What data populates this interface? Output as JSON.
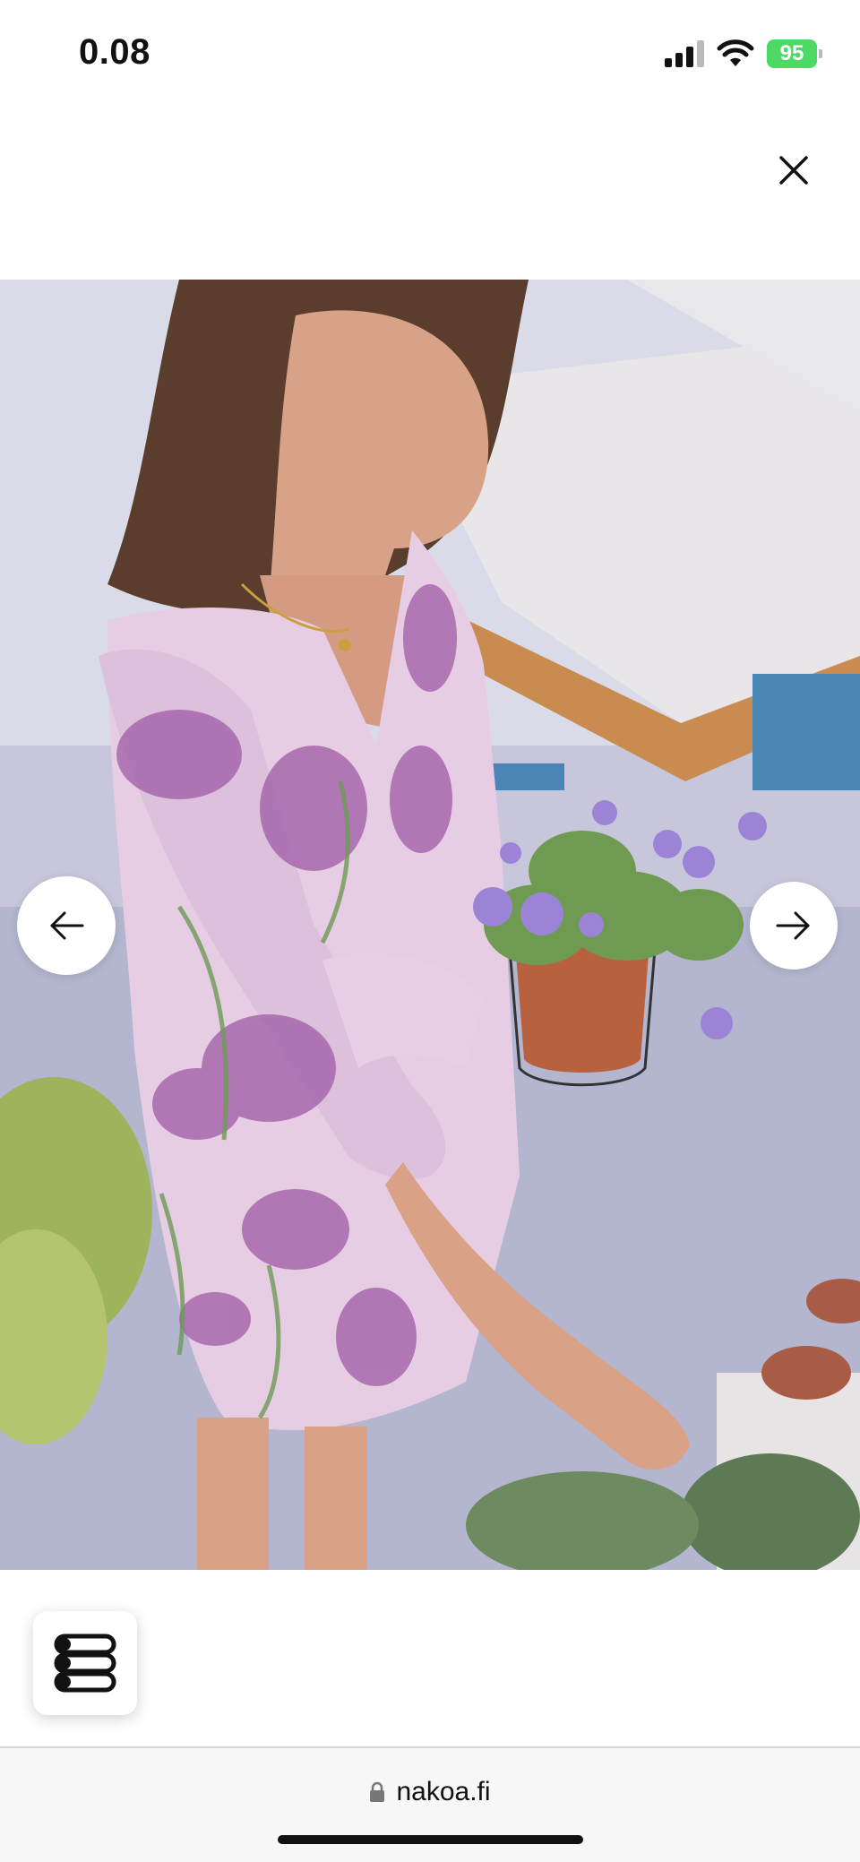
{
  "status_bar": {
    "time": "0.08",
    "battery": "95",
    "icons": [
      "signal-icon",
      "wifi-icon",
      "battery-charging-icon"
    ]
  },
  "overlay": {
    "close_icon": "close-icon",
    "prev_icon": "arrow-left-icon",
    "next_icon": "arrow-right-icon",
    "menu_icon": "menu-logo-icon"
  },
  "browser": {
    "url": "nakoa.fi",
    "lock_icon": "lock-icon"
  },
  "colors": {
    "battery": "#4cd964",
    "dress": "#e6cde4",
    "floral_accent": "#a05ba6",
    "pot": "#b8613f"
  }
}
